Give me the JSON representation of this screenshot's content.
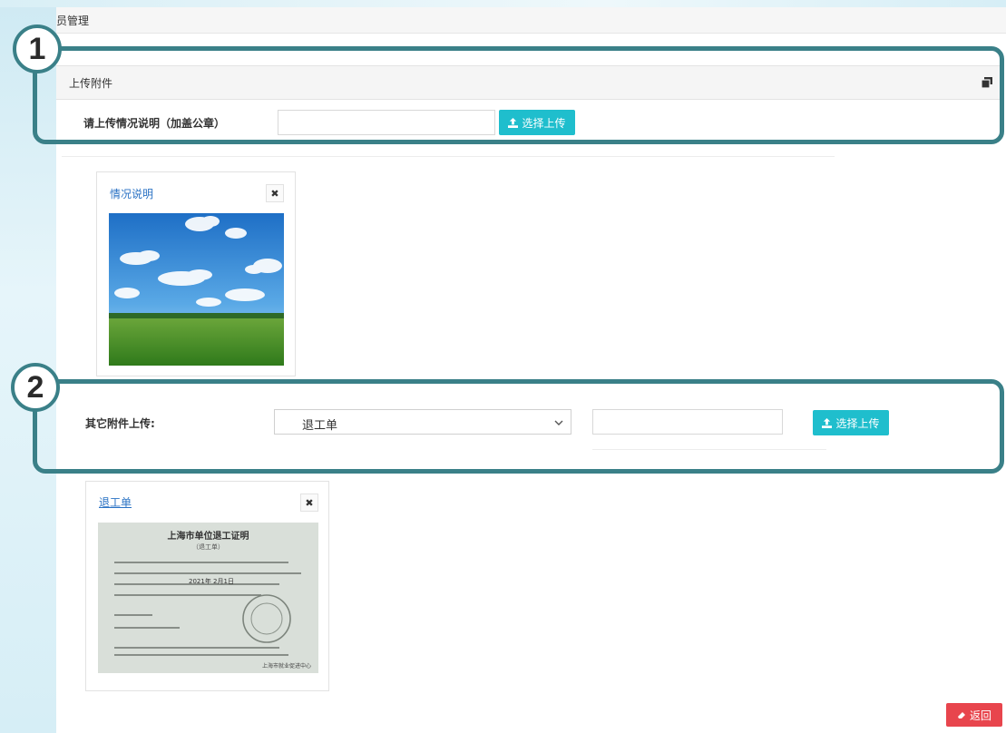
{
  "breadcrumb": {
    "text": "员管理"
  },
  "section1": {
    "panel_title": "上传附件",
    "label": "请上传情况说明（加盖公章）",
    "input_value": "",
    "upload_label": "选择上传"
  },
  "card1": {
    "title": "情况说明",
    "close_glyph": "✖",
    "image_desc": "sky-grass-photo"
  },
  "section2": {
    "label": "其它附件上传:",
    "select_value": "退工单",
    "input_value": "",
    "upload_label": "选择上传"
  },
  "card2": {
    "title": "退工单",
    "close_glyph": "✖",
    "document": {
      "heading": "上海市单位退工证明",
      "line1": "（退工单）",
      "line2": "2021年 2月1日",
      "note": "上海市就业促进中心"
    }
  },
  "annotations": {
    "one": "1",
    "two": "2"
  },
  "back_button": {
    "label": "返回"
  },
  "colors": {
    "accent": "#1fbecd",
    "annotation": "#3a8088",
    "danger": "#e8454d",
    "link": "#2a72c4"
  }
}
